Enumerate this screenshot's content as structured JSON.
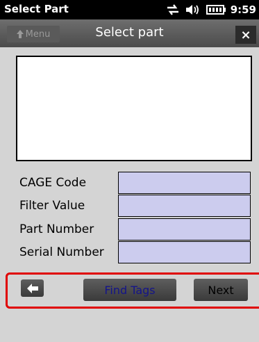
{
  "statusbar": {
    "app_title": "Select Part",
    "time": "9:59"
  },
  "titlebar": {
    "menu_label": "Menu",
    "title": "Select part",
    "close_label": "×"
  },
  "form": {
    "fields": [
      {
        "label": "CAGE Code",
        "value": ""
      },
      {
        "label": "Filter Value",
        "value": ""
      },
      {
        "label": "Part Number",
        "value": ""
      },
      {
        "label": "Serial Number",
        "value": ""
      }
    ]
  },
  "actions": {
    "find_tags_label": "Find Tags",
    "next_label": "Next"
  }
}
